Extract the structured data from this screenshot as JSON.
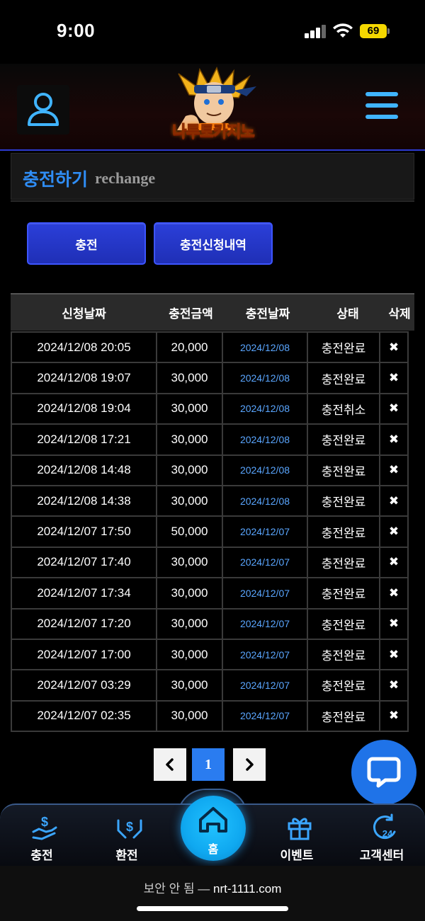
{
  "status_bar": {
    "time": "9:00",
    "battery": "69"
  },
  "header": {
    "logo_text": "나루토카지노"
  },
  "section": {
    "title_ko": "충전하기",
    "title_en": "rechange"
  },
  "buttons": {
    "charge": "충전",
    "history": "충전신청내역"
  },
  "table": {
    "columns": [
      "신청날짜",
      "충전금액",
      "충전날짜",
      "상태",
      "삭제"
    ],
    "rows": [
      {
        "requested": "2024/12/08 20:05",
        "amount": "20,000",
        "charged": "2024/12/08",
        "status": "충전완료"
      },
      {
        "requested": "2024/12/08 19:07",
        "amount": "30,000",
        "charged": "2024/12/08",
        "status": "충전완료"
      },
      {
        "requested": "2024/12/08 19:04",
        "amount": "30,000",
        "charged": "2024/12/08",
        "status": "충전취소"
      },
      {
        "requested": "2024/12/08 17:21",
        "amount": "30,000",
        "charged": "2024/12/08",
        "status": "충전완료"
      },
      {
        "requested": "2024/12/08 14:48",
        "amount": "30,000",
        "charged": "2024/12/08",
        "status": "충전완료"
      },
      {
        "requested": "2024/12/08 14:38",
        "amount": "30,000",
        "charged": "2024/12/08",
        "status": "충전완료"
      },
      {
        "requested": "2024/12/07 17:50",
        "amount": "50,000",
        "charged": "2024/12/07",
        "status": "충전완료"
      },
      {
        "requested": "2024/12/07 17:40",
        "amount": "30,000",
        "charged": "2024/12/07",
        "status": "충전완료"
      },
      {
        "requested": "2024/12/07 17:34",
        "amount": "30,000",
        "charged": "2024/12/07",
        "status": "충전완료"
      },
      {
        "requested": "2024/12/07 17:20",
        "amount": "30,000",
        "charged": "2024/12/07",
        "status": "충전완료"
      },
      {
        "requested": "2024/12/07 17:00",
        "amount": "30,000",
        "charged": "2024/12/07",
        "status": "충전완료"
      },
      {
        "requested": "2024/12/07 03:29",
        "amount": "30,000",
        "charged": "2024/12/07",
        "status": "충전완료"
      },
      {
        "requested": "2024/12/07 02:35",
        "amount": "30,000",
        "charged": "2024/12/07",
        "status": "충전완료"
      }
    ],
    "delete_symbol": "✖"
  },
  "pagination": {
    "prev": "‹",
    "current": "1",
    "next": "›"
  },
  "bottom_nav": {
    "items": [
      {
        "label": "충전",
        "icon": "hand-dollar-icon"
      },
      {
        "label": "환전",
        "icon": "hands-dollar-icon"
      },
      {
        "label": "홈",
        "icon": "home-icon"
      },
      {
        "label": "이벤트",
        "icon": "gift-icon"
      },
      {
        "label": "고객센터",
        "icon": "support-24-icon"
      }
    ]
  },
  "browser": {
    "security": "보안 안 됨 —",
    "host": "nrt-1111.com"
  },
  "colors": {
    "accent": "#2f8df5",
    "button": "#2b3fd9",
    "link_date": "#5aa6ff",
    "home": "#0fa8f0"
  }
}
